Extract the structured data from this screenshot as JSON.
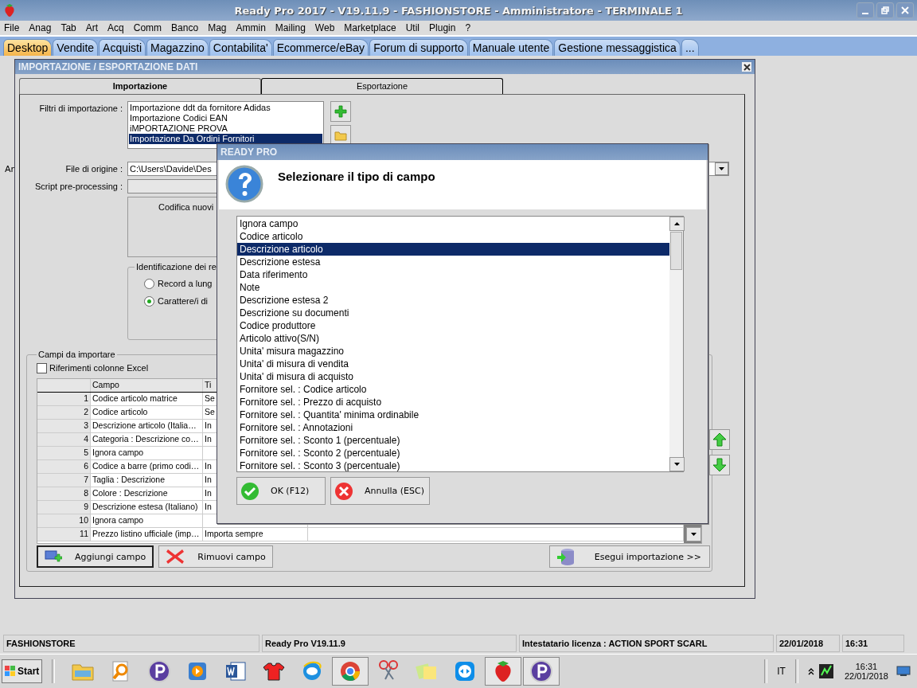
{
  "window": {
    "title": "Ready Pro 2017 - V19.11.9 - FASHIONSTORE - Amministratore - TERMINALE 1"
  },
  "menu": [
    "File",
    "Anag",
    "Tab",
    "Art",
    "Acq",
    "Comm",
    "Banco",
    "Mag",
    "Ammin",
    "Mailing",
    "Web",
    "Marketplace",
    "Util",
    "Plugin",
    "?"
  ],
  "tabs": [
    {
      "label": "Desktop",
      "selected": true
    },
    {
      "label": "Vendite",
      "selected": false
    },
    {
      "label": "Acquisti",
      "selected": false
    },
    {
      "label": "Magazzino",
      "selected": false
    },
    {
      "label": "Contabilita'",
      "selected": false
    },
    {
      "label": "Ecommerce/eBay",
      "selected": false
    },
    {
      "label": "Forum di supporto",
      "selected": false
    },
    {
      "label": "Manuale utente",
      "selected": false
    },
    {
      "label": "Gestione messaggistica",
      "selected": false
    },
    {
      "label": "...",
      "selected": false
    }
  ],
  "desktop_label": "Ar",
  "import_window": {
    "title": "IMPORTAZIONE / ESPORTAZIONE DATI",
    "tabs": [
      {
        "label": "Importazione",
        "selected": true
      },
      {
        "label": "Esportazione",
        "selected": false
      }
    ],
    "filters_label": "Filtri di importazione :",
    "filters": [
      {
        "label": "Importazione ddt da fornitore Adidas",
        "selected": false
      },
      {
        "label": "Importazione Codici EAN",
        "selected": false
      },
      {
        "label": "iMPORTAZIONE PROVA",
        "selected": false
      },
      {
        "label": "Importazione Da Ordini Fornitori",
        "selected": true
      }
    ],
    "source_label": "File di origine :",
    "source_value": "C:\\Users\\Davide\\Des",
    "script_label": "Script pre-processing :",
    "encoding_label": "Codifica nuovi",
    "record_group": {
      "title": "Identificazione dei re",
      "options": [
        {
          "label": "Record a lung",
          "selected": false
        },
        {
          "label": "Carattere/i di",
          "selected": true
        }
      ]
    },
    "fields_group": {
      "title": "Campi da importare",
      "excel_refs": {
        "label": "Riferimenti colonne Excel",
        "checked": false
      },
      "columns": [
        "Campo",
        "Ti"
      ],
      "rows": [
        {
          "number": "1",
          "field": "Codice articolo matrice",
          "mode": "Se"
        },
        {
          "number": "2",
          "field": "Codice articolo",
          "mode": "Se"
        },
        {
          "number": "3",
          "field": "Descrizione articolo (Italia…",
          "mode": "In"
        },
        {
          "number": "4",
          "field": "Categoria : Descrizione co…",
          "mode": "In"
        },
        {
          "number": "5",
          "field": "Ignora campo"
        },
        {
          "number": "6",
          "field": "Codice a barre (primo codi…",
          "mode": "In"
        },
        {
          "number": "7",
          "field": "Taglia : Descrizione",
          "mode": "In"
        },
        {
          "number": "8",
          "field": "Colore : Descrizione",
          "mode": "In"
        },
        {
          "number": "9",
          "field": "Descrizione estesa (Italiano)",
          "mode": "In"
        },
        {
          "number": "10",
          "field": "Ignora campo"
        },
        {
          "number": "11",
          "field": "Prezzo listino ufficiale (imp…",
          "mode": "Importa sempre"
        }
      ],
      "buttons": [
        {
          "label": "Aggiungi campo",
          "kind": "add"
        },
        {
          "label": "Rimuovi campo",
          "kind": "remove"
        }
      ]
    },
    "run_button": "Esegui importazione >>"
  },
  "dialog": {
    "title": "READY PRO",
    "prompt": "Selezionare il tipo di campo",
    "options": [
      {
        "label": "Ignora campo",
        "selected": false
      },
      {
        "label": "Codice articolo",
        "selected": false
      },
      {
        "label": "Descrizione articolo",
        "selected": true
      },
      {
        "label": "Descrizione estesa",
        "selected": false
      },
      {
        "label": "Data riferimento",
        "selected": false
      },
      {
        "label": "Note",
        "selected": false
      },
      {
        "label": "Descrizione estesa 2",
        "selected": false
      },
      {
        "label": "Descrizione su documenti",
        "selected": false
      },
      {
        "label": "Codice produttore",
        "selected": false
      },
      {
        "label": "Articolo attivo(S/N)",
        "selected": false
      },
      {
        "label": "Unita' misura magazzino",
        "selected": false
      },
      {
        "label": "Unita' di misura di vendita",
        "selected": false
      },
      {
        "label": "Unita' di misura di acquisto",
        "selected": false
      },
      {
        "label": "Fornitore sel. : Codice articolo",
        "selected": false
      },
      {
        "label": "Fornitore sel. : Prezzo di acquisto",
        "selected": false
      },
      {
        "label": "Fornitore sel. : Quantita' minima ordinabile",
        "selected": false
      },
      {
        "label": "Fornitore sel. : Annotazioni",
        "selected": false
      },
      {
        "label": "Fornitore sel. : Sconto 1 (percentuale)",
        "selected": false
      },
      {
        "label": "Fornitore sel. : Sconto 2 (percentuale)",
        "selected": false
      },
      {
        "label": "Fornitore sel. : Sconto 3 (percentuale)",
        "selected": false
      }
    ],
    "buttons": [
      {
        "label": "OK (F12)",
        "kind": "ok"
      },
      {
        "label": "Annulla (ESC)",
        "kind": "cancel"
      }
    ]
  },
  "status_bar": [
    "FASHIONSTORE",
    "Ready Pro V19.11.9",
    "Intestatario licenza : ACTION SPORT SCARL",
    "22/01/2018",
    "16:31"
  ],
  "taskbar": {
    "start": "Start",
    "language": "IT",
    "time": "16:31",
    "date": "22/01/2018"
  }
}
